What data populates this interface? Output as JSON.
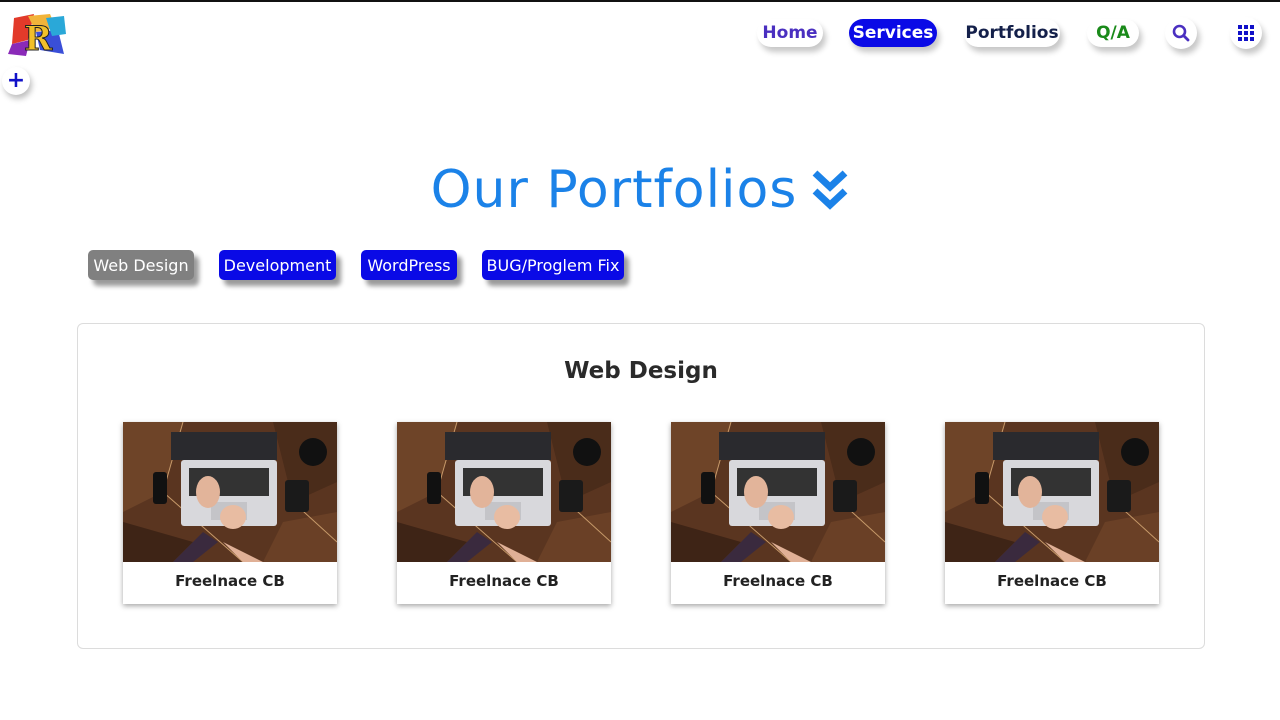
{
  "nav": {
    "home": "Home",
    "services": "Services",
    "portfolios": "Portfolios",
    "qa": "Q/A",
    "search_icon": "search-icon",
    "grid_icon": "grid-icon"
  },
  "logo": {
    "icon": "logo-icon"
  },
  "sidebar": {
    "plus_label": "+"
  },
  "page": {
    "title": "Our Portfolios"
  },
  "tabs": [
    {
      "label": "Web Design",
      "active": true
    },
    {
      "label": "Development",
      "active": false
    },
    {
      "label": "WordPress",
      "active": false
    },
    {
      "label": "BUG/Proglem Fix",
      "active": false
    }
  ],
  "panel": {
    "title": "Web Design",
    "cards": [
      {
        "caption": "Freelnace CB"
      },
      {
        "caption": "Freelnace CB"
      },
      {
        "caption": "Freelnace CB"
      },
      {
        "caption": "Freelnace CB"
      }
    ]
  },
  "colors": {
    "accent_blue": "#0a0ae6",
    "title_blue": "#1b82e8",
    "active_tab_gray": "#808080",
    "qa_green": "#1a8a1a"
  }
}
